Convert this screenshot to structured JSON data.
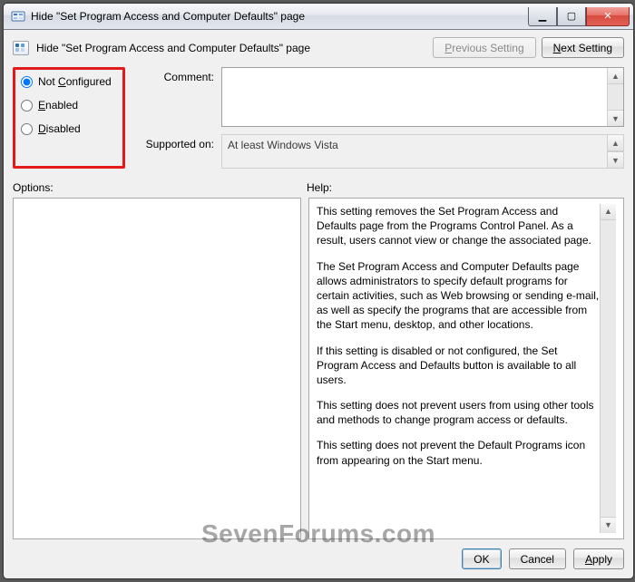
{
  "window": {
    "title": "Hide \"Set Program Access and Computer Defaults\" page"
  },
  "header": {
    "page_title": "Hide \"Set Program Access and Computer Defaults\" page",
    "previous_accel": "P",
    "previous_rest": "revious Setting",
    "next_accel": "N",
    "next_rest": "ext Setting"
  },
  "state": {
    "not_configured_accel": "C",
    "not_configured_pre": "Not ",
    "not_configured_post": "onfigured",
    "enabled_accel": "E",
    "enabled_rest": "nabled",
    "disabled_accel": "D",
    "disabled_rest": "isabled",
    "selected": "not_configured"
  },
  "fields": {
    "comment_label": "Comment:",
    "comment_value": "",
    "supported_label": "Supported on:",
    "supported_value": "At least Windows Vista"
  },
  "panels": {
    "options_label": "Options:",
    "help_label": "Help:"
  },
  "help": {
    "p1": "This setting removes the Set Program Access and Defaults page from the Programs Control Panel.  As a result, users cannot view or change the associated page.",
    "p2": "The Set Program Access and Computer Defaults page allows administrators to specify default programs for certain activities, such as Web browsing or sending e-mail, as well as specify the programs that are accessible from the Start menu, desktop, and other locations.",
    "p3": "If this setting is disabled or not configured, the Set Program Access and Defaults button is available to all users.",
    "p4": "This setting does not prevent users from using other tools and methods to change program access or defaults.",
    "p5": "This setting does not prevent the Default Programs icon from appearing on the Start menu."
  },
  "footer": {
    "ok": "OK",
    "cancel": "Cancel",
    "apply_accel": "A",
    "apply_rest": "pply"
  },
  "watermark": "SevenForums.com"
}
